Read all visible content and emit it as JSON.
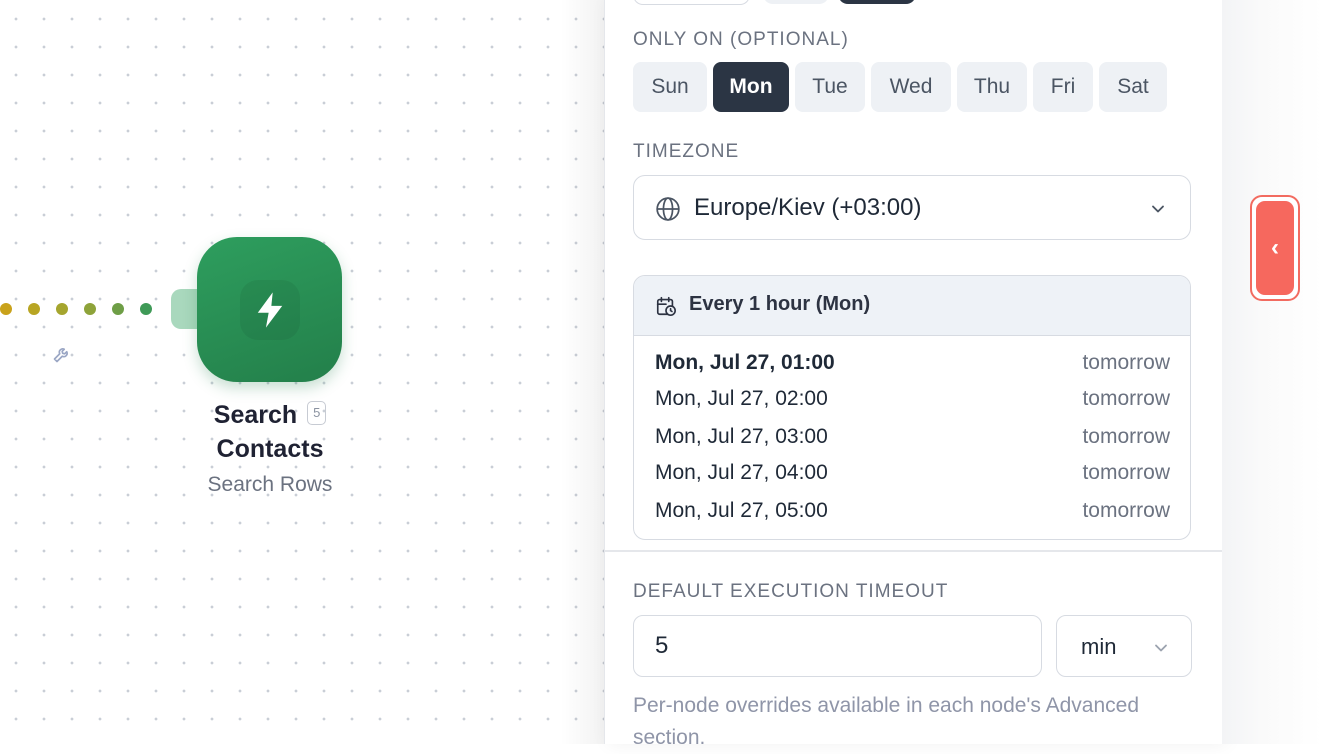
{
  "canvas": {
    "node": {
      "title": "Search Contacts",
      "badge": "5",
      "subtitle": "Search Rows",
      "icon": "lightning-icon",
      "color": "#2a8f54"
    },
    "connector_icon": "wrench-icon"
  },
  "panel": {
    "days_label": "ONLY ON (OPTIONAL)",
    "days": [
      {
        "label": "Sun",
        "selected": false
      },
      {
        "label": "Mon",
        "selected": true
      },
      {
        "label": "Tue",
        "selected": false
      },
      {
        "label": "Wed",
        "selected": false
      },
      {
        "label": "Thu",
        "selected": false
      },
      {
        "label": "Fri",
        "selected": false
      },
      {
        "label": "Sat",
        "selected": false
      }
    ],
    "timezone_label": "TIMEZONE",
    "timezone_value": "Europe/Kiev (+03:00)",
    "schedule": {
      "title": "Every 1 hour (Mon)",
      "runs": [
        {
          "when": "Mon, Jul 27, 01:00",
          "relative": "tomorrow"
        },
        {
          "when": "Mon, Jul 27, 02:00",
          "relative": "tomorrow"
        },
        {
          "when": "Mon, Jul 27, 03:00",
          "relative": "tomorrow"
        },
        {
          "when": "Mon, Jul 27, 04:00",
          "relative": "tomorrow"
        },
        {
          "when": "Mon, Jul 27, 05:00",
          "relative": "tomorrow"
        }
      ]
    },
    "timeout_label": "DEFAULT EXECUTION TIMEOUT",
    "timeout_value": "5",
    "timeout_unit": "min",
    "help_text": "Per-node overrides available in each node's Advanced section."
  },
  "collapse_button": {
    "label": "‹",
    "color": "#f6685e"
  },
  "colors": {
    "selected_day": "#2b3544",
    "accent": "#f6685e"
  }
}
